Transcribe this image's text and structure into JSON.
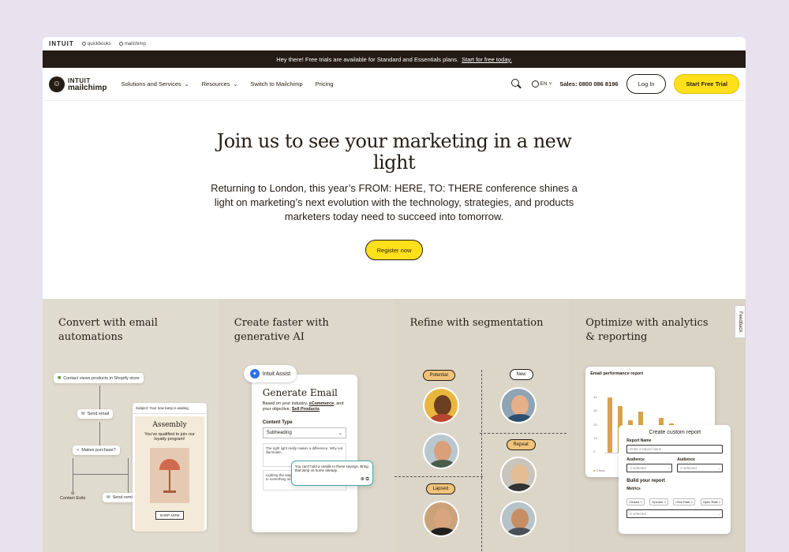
{
  "topstrip": {
    "intuit": "INTUIT",
    "brands": [
      "quickbooks",
      "mailchimp"
    ]
  },
  "banner": {
    "text": "Hey there! Free trials are available for Standard and Essentials plans.",
    "link": "Start for free today."
  },
  "nav": {
    "logo_line1": "INTUIT",
    "logo_line2": "mailchimp",
    "items": [
      {
        "label": "Solutions and Services",
        "dropdown": true
      },
      {
        "label": "Resources",
        "dropdown": true
      },
      {
        "label": "Switch to Mailchimp",
        "dropdown": false
      },
      {
        "label": "Pricing",
        "dropdown": false
      }
    ],
    "lang": "EN",
    "sales": "Sales: 0800 086 8196",
    "login": "Log In",
    "trial": "Start Free Trial"
  },
  "hero": {
    "title": "Join us to see your marketing in a new light",
    "body": "Returning to London, this year’s FROM: HERE, TO: THERE conference shines a light on marketing’s next evolution with the technology, strategies, and products marketers today need to succeed into tomorrow.",
    "cta": "Register now"
  },
  "features": [
    {
      "title": "Convert with email automations"
    },
    {
      "title": "Create faster with generative AI"
    },
    {
      "title": "Refine with segmentation"
    },
    {
      "title": "Optimize with analytics & reporting"
    }
  ],
  "automation": {
    "shopify": "Contact views products in Shopify store",
    "send_email": "Send email",
    "makes_purchase": "Makes purchase?",
    "contact_exits": "Contact Exits",
    "send_reminder": "Send reminder",
    "email_subject": "Subject: Your new lamp is waiting",
    "email_brand": "Assembly",
    "email_body": "You've qualified to join our loyalty program!",
    "email_cta": "SHOP NOW"
  },
  "genai": {
    "badge": "Intuit Assist",
    "title": "Generate Email",
    "desc_prefix": "Based on your industry,",
    "desc_link1": "eCommerce",
    "desc_mid": ", and your objective,",
    "desc_link2": "Sell Products",
    "content_type_label": "Content Type",
    "content_type_value": "Subheading",
    "option1": "The right light really makes a difference. Why not illuminate...",
    "option2": "You can't hold a candle to these savings. Bring that lamp on home already.",
    "option3": "Lighting the way to feeling good. Treat yourself to something nice today."
  },
  "segments": {
    "potential": "Potential",
    "new": "New",
    "repeat": "Repeat",
    "lapsed": "Lapsed"
  },
  "analytics": {
    "report_title": "Email performance report",
    "bars": [
      0.95,
      0.8,
      0.55,
      0.7,
      0.4,
      0.6,
      0.5,
      0.35,
      0.45,
      0.3
    ],
    "y_ticks": [
      "40",
      "30",
      "20",
      "10",
      "0"
    ],
    "custom_title": "Create custom report",
    "report_name_label": "Report Name",
    "report_name_placeholder": "Enter a report name",
    "audience_label": "Audience",
    "audience_value": "2 selected",
    "audience2_label": "Audience",
    "audience2_value": "2 selected",
    "build_label": "Build your report",
    "metrics_label": "Metrics",
    "metrics": [
      "Clicked",
      "Opened",
      "Click Rate",
      "Open Rate"
    ],
    "metrics_value": "6 selected",
    "legend": "Clicks"
  },
  "feedback": "Feedback",
  "colors": {
    "accent": "#ffe01b",
    "dark": "#241c15",
    "bar": "#d9a24a"
  }
}
